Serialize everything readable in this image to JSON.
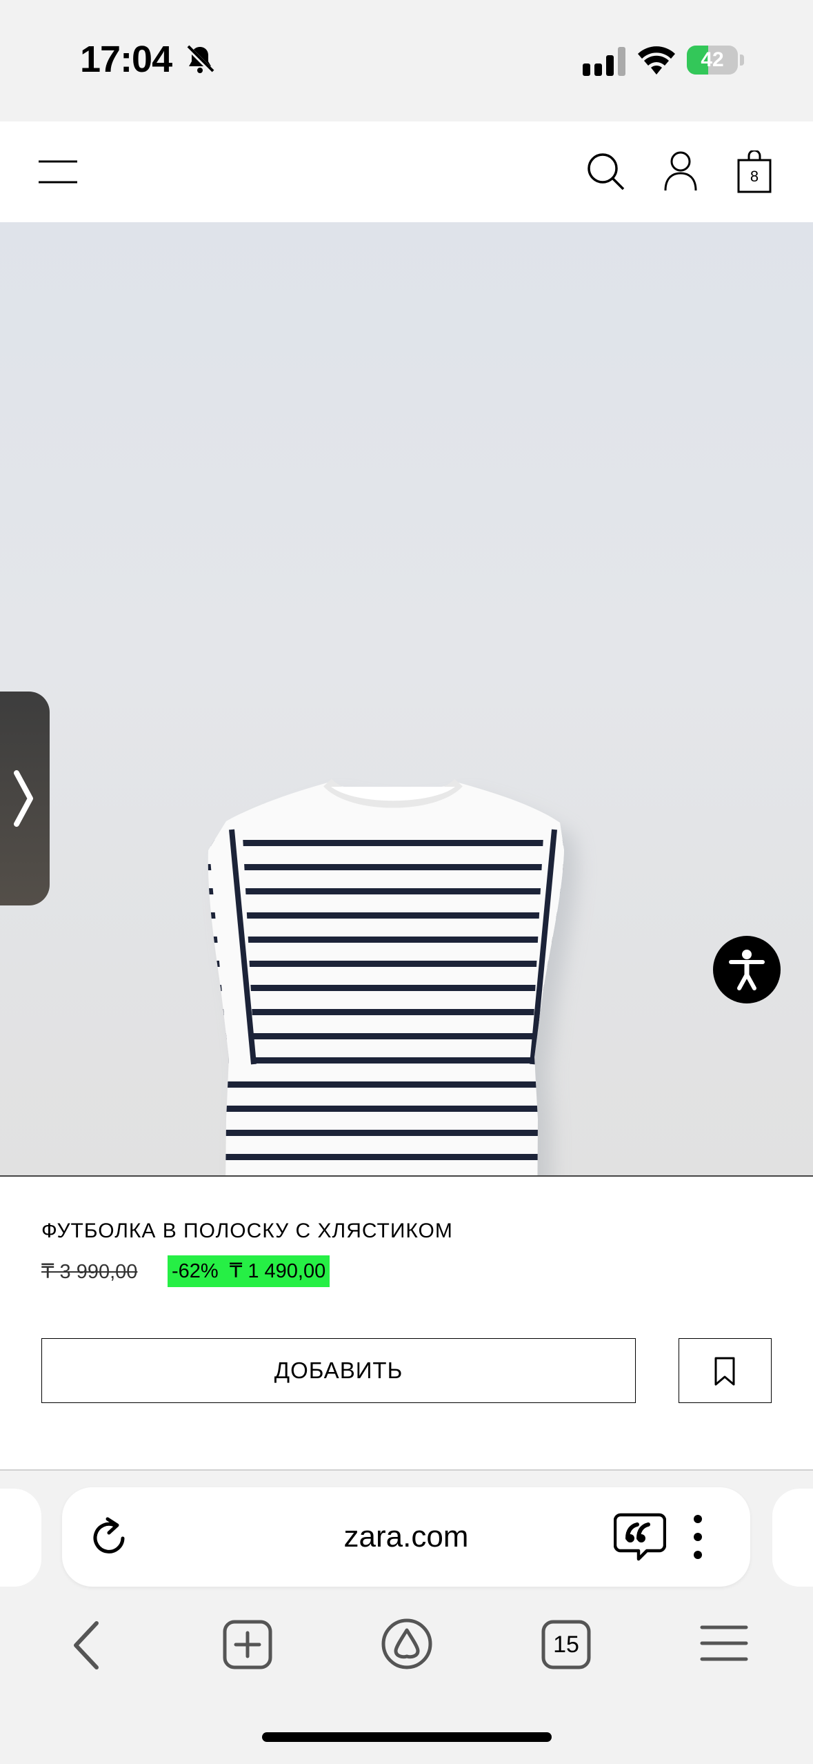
{
  "status_bar": {
    "time": "17:04",
    "battery_level": "42",
    "battery_fraction": 0.42,
    "icons": [
      "bell-slash-icon",
      "cellular-signal-icon",
      "wifi-icon",
      "battery-charging-icon"
    ]
  },
  "header": {
    "bag_count": "8",
    "icons": [
      "menu-icon",
      "search-icon",
      "account-icon",
      "shopping-bag-icon"
    ]
  },
  "product": {
    "name": "ФУТБОЛКА В ПОЛОСКУ С ХЛЯСТИКОМ",
    "old_price": "₸ 3 990,00",
    "discount": "-62%",
    "price": "₸ 1 490,00",
    "add_label": "ДОБАВИТЬ",
    "image_icon": "striped-sleeveless-tshirt-photo"
  },
  "browser": {
    "url": "zara.com",
    "tabs_count": "15",
    "icons": [
      "reload-icon",
      "quote-icon",
      "more-vertical-icon",
      "back-icon",
      "new-tab-icon",
      "alice-icon",
      "tabs-icon",
      "hamburger-icon"
    ]
  },
  "colors": {
    "sale_highlight": "#26ef45",
    "battery_green": "#33c759",
    "background": "#f2f2f2"
  }
}
